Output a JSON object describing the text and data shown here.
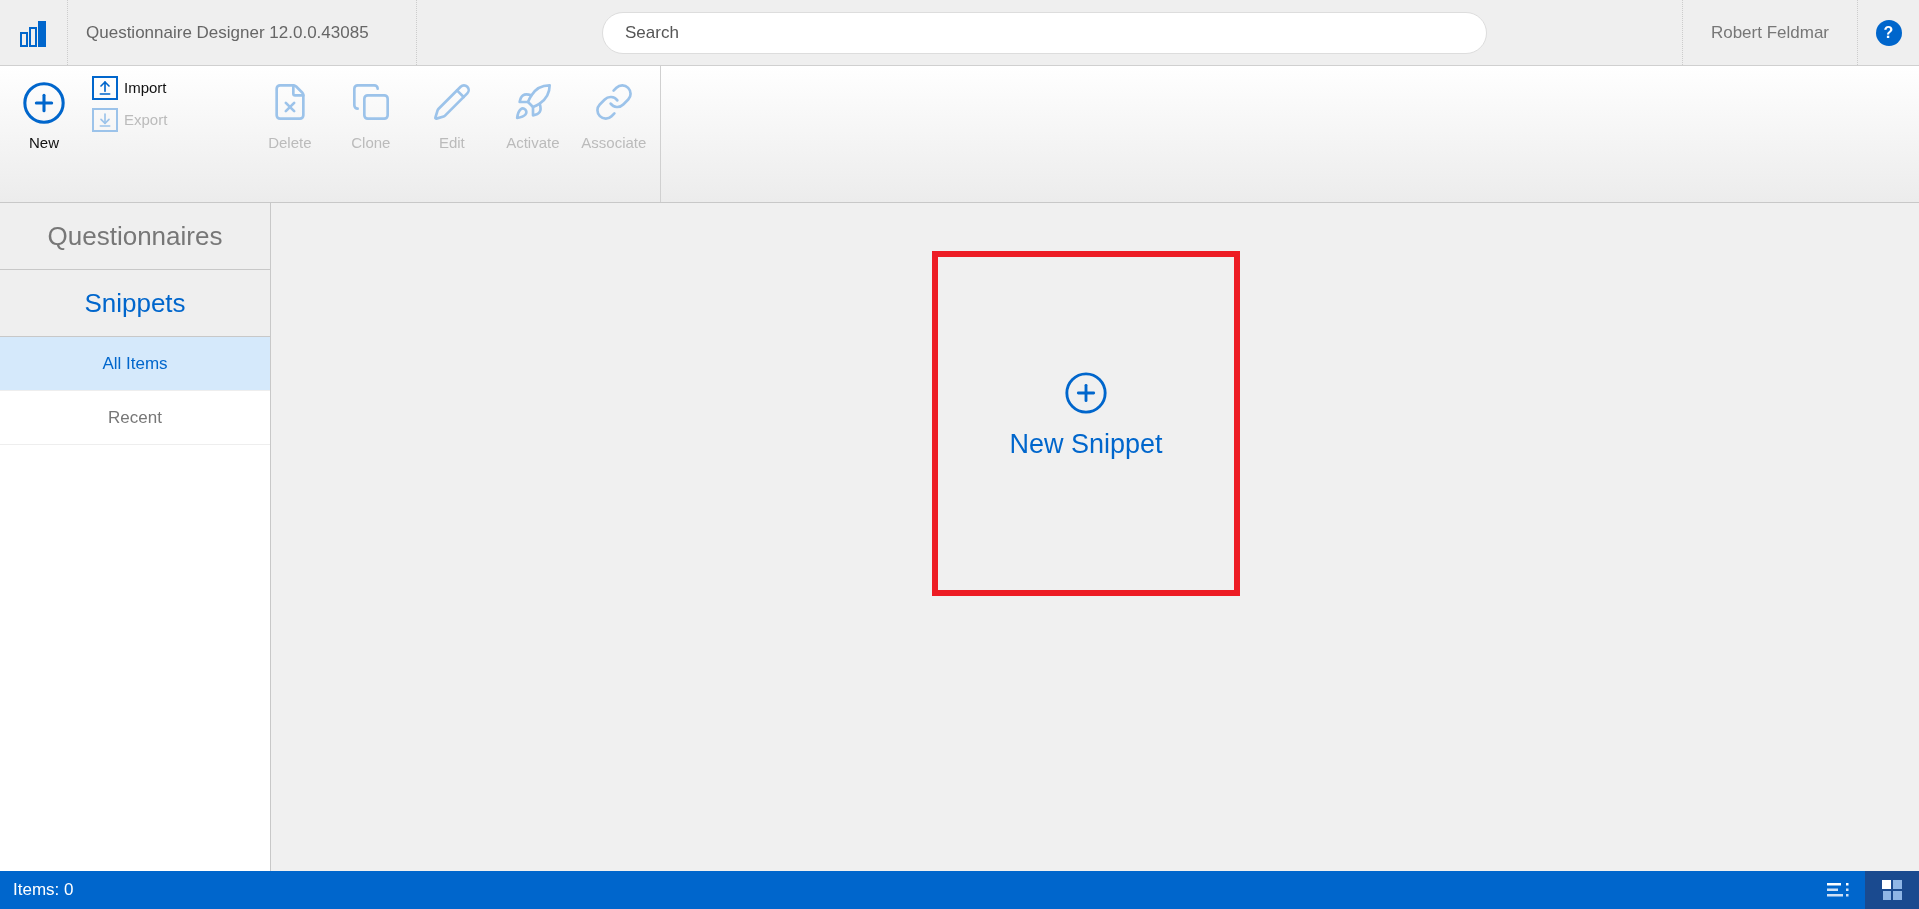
{
  "header": {
    "title": "Questionnaire Designer 12.0.0.43085",
    "search": {
      "placeholder": "Search"
    },
    "user": "Robert Feldmar",
    "help": "?"
  },
  "toolbar": {
    "new": {
      "label": "New",
      "disabled": false
    },
    "file_actions": [
      {
        "label": "Import",
        "disabled": false
      },
      {
        "label": "Export",
        "disabled": true
      }
    ],
    "actions": [
      {
        "label": "Delete",
        "disabled": true
      },
      {
        "label": "Clone",
        "disabled": true
      },
      {
        "label": "Edit",
        "disabled": true
      },
      {
        "label": "Activate",
        "disabled": true
      },
      {
        "label": "Associate",
        "disabled": true
      }
    ]
  },
  "sidebar": {
    "sections": [
      {
        "label": "Questionnaires",
        "selected": false
      },
      {
        "label": "Snippets",
        "selected": true
      }
    ],
    "items": [
      {
        "label": "All Items",
        "selected": true
      },
      {
        "label": "Recent",
        "selected": false
      }
    ]
  },
  "main": {
    "new_card": {
      "label": "New Snippet",
      "highlighted": true
    }
  },
  "status_bar": {
    "text": "Items: 0",
    "views": [
      {
        "kind": "list",
        "selected": false
      },
      {
        "kind": "tiles",
        "selected": true
      }
    ]
  }
}
